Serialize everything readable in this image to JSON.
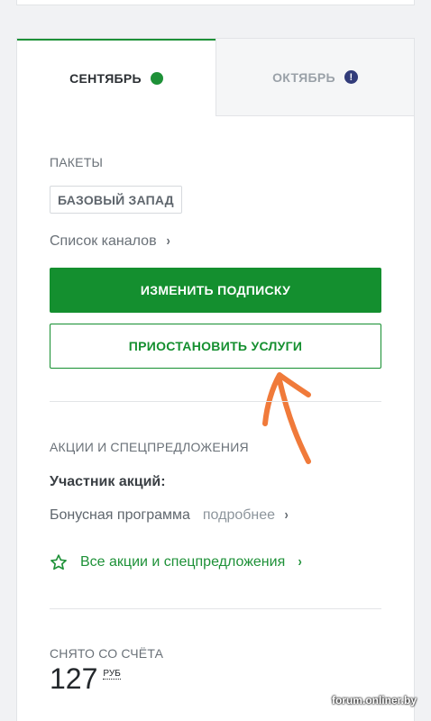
{
  "tabs": [
    {
      "label": "СЕНТЯБРЬ",
      "status": "ok"
    },
    {
      "label": "ОКТЯБРЬ",
      "status": "alert",
      "status_glyph": "!"
    }
  ],
  "packages": {
    "section_label": "ПАКЕТЫ",
    "badge": "БАЗОВЫЙ ЗАПАД",
    "channels_link": "Список каналов",
    "change_button": "ИЗМЕНИТЬ ПОДПИСКУ",
    "pause_button": "ПРИОСТАНОВИТЬ УСЛУГИ"
  },
  "promos": {
    "section_label": "АКЦИИ И СПЕЦПРЕДЛОЖЕНИЯ",
    "participant": "Участник акций:",
    "bonus_label": "Бонусная программа",
    "bonus_more": "подробнее",
    "all_link": "Все акции и спецпредложения"
  },
  "charged": {
    "section_label": "СНЯТО СО СЧЁТА",
    "amount": "127",
    "currency": "РУБ"
  },
  "watermark": "forum.onliner.by",
  "icons": {
    "chevron": "›",
    "star": "star-outline-icon"
  },
  "colors": {
    "accent": "#148f2f",
    "alert": "#323c7a",
    "annotation": "#f07a3a"
  }
}
